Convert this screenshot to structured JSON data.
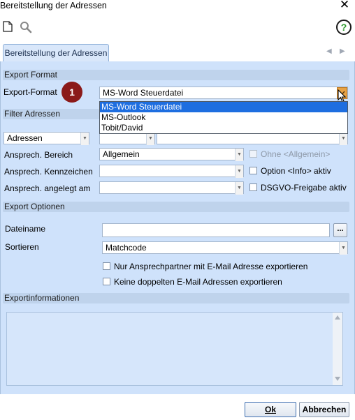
{
  "window": {
    "title": "Bereitstellung der Adressen"
  },
  "tab": {
    "label": "Bereitstellung der Adressen"
  },
  "sections": {
    "export_format": "Export Format",
    "filter_adressen": "Filter Adressen",
    "export_optionen": "Export Optionen",
    "exportinformationen": "Exportinformationen"
  },
  "export_format": {
    "label": "Export-Format",
    "value": "MS-Word Steuerdatei",
    "options": [
      "MS-Word Steuerdatei",
      "MS-Outlook",
      "Tobit/David"
    ],
    "badge": "1"
  },
  "filter": {
    "type_value": "Adressen",
    "ansprech_bereich_label": "Ansprech. Bereich",
    "ansprech_bereich_value": "Allgemein",
    "ansprech_kennzeichen_label": "Ansprech. Kennzeichen",
    "ansprech_kennzeichen_value": "",
    "ansprech_angelegt_label": "Ansprech. angelegt am",
    "ansprech_angelegt_value": "",
    "ohne_allgemein_label": "Ohne <Allgemein>",
    "option_info_label": "Option <Info> aktiv",
    "dsgvo_label": "DSGVO-Freigabe aktiv"
  },
  "export_options": {
    "dateiname_label": "Dateiname",
    "dateiname_value": "",
    "browse_label": "...",
    "sortieren_label": "Sortieren",
    "sortieren_value": "Matchcode",
    "only_email_label": "Nur Ansprechpartner mit E-Mail Adresse exportieren",
    "no_duplicates_label": "Keine doppelten E-Mail Adressen exportieren"
  },
  "buttons": {
    "ok": "Ok",
    "cancel": "Abbrechen"
  },
  "icons": {
    "new": "new-document-icon",
    "search": "search-icon",
    "help": "help-icon",
    "close": "close-icon"
  },
  "colors": {
    "panel": "#cfe2fb",
    "section": "#bfd3ec",
    "selection": "#1e6ee0",
    "badge": "#8b1a1a",
    "help_green": "#2f9b2f"
  }
}
